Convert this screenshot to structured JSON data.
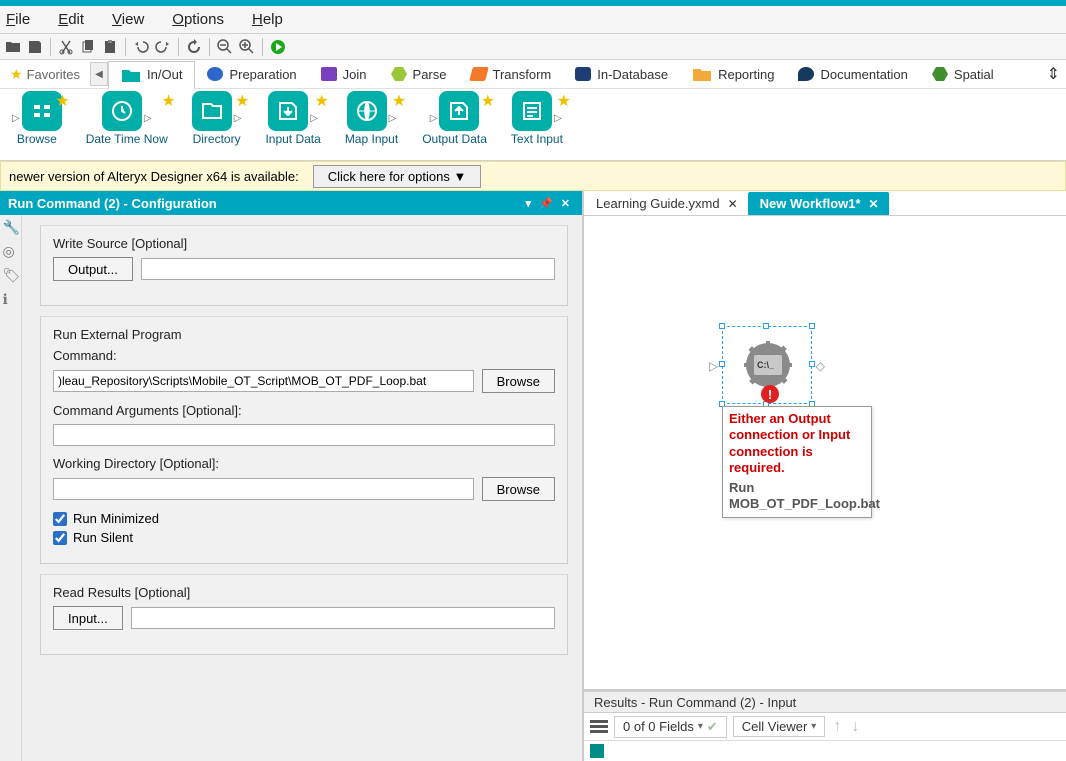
{
  "menu": {
    "file": "File",
    "edit": "Edit",
    "view": "View",
    "options": "Options",
    "help": "Help"
  },
  "categories": {
    "favorites": "Favorites",
    "items": [
      {
        "label": "In/Out",
        "color": "#00B0A8"
      },
      {
        "label": "Preparation",
        "color": "#2E66C9"
      },
      {
        "label": "Join",
        "color": "#7A3FBF"
      },
      {
        "label": "Parse",
        "color": "#9AC63A"
      },
      {
        "label": "Transform",
        "color": "#F27A2A"
      },
      {
        "label": "In-Database",
        "color": "#1E3E73"
      },
      {
        "label": "Reporting",
        "color": "#F2A93A"
      },
      {
        "label": "Documentation",
        "color": "#163A5F"
      },
      {
        "label": "Spatial",
        "color": "#3F8F2E"
      }
    ]
  },
  "palette": [
    {
      "label": "Browse"
    },
    {
      "label": "Date Time Now"
    },
    {
      "label": "Directory"
    },
    {
      "label": "Input Data"
    },
    {
      "label": "Map Input"
    },
    {
      "label": "Output Data"
    },
    {
      "label": "Text Input"
    }
  ],
  "notice": {
    "text": "newer version of Alteryx Designer x64 is available:",
    "button": "Click here for options ▼"
  },
  "config": {
    "title": "Run Command (2) - Configuration",
    "write_source": "Write Source [Optional]",
    "output_btn": "Output...",
    "run_ext": "Run External Program",
    "command_lbl": "Command:",
    "command_val": ")leau_Repository\\Scripts\\Mobile_OT_Script\\MOB_OT_PDF_Loop.bat",
    "browse": "Browse",
    "args_lbl": "Command Arguments [Optional]:",
    "wd_lbl": "Working Directory [Optional]:",
    "run_min": "Run Minimized",
    "run_silent": "Run Silent",
    "read_results": "Read Results [Optional]",
    "input_btn": "Input..."
  },
  "tabs": {
    "t1": "Learning Guide.yxmd",
    "t2": "New Workflow1*"
  },
  "node": {
    "cmd": "C:\\_",
    "error": "Either an Output connection or Input connection is required.",
    "sub": "Run MOB_OT_PDF_Loop.bat"
  },
  "results": {
    "title": "Results - Run Command (2) - Input",
    "fields": "0 of 0 Fields",
    "cellviewer": "Cell Viewer"
  }
}
